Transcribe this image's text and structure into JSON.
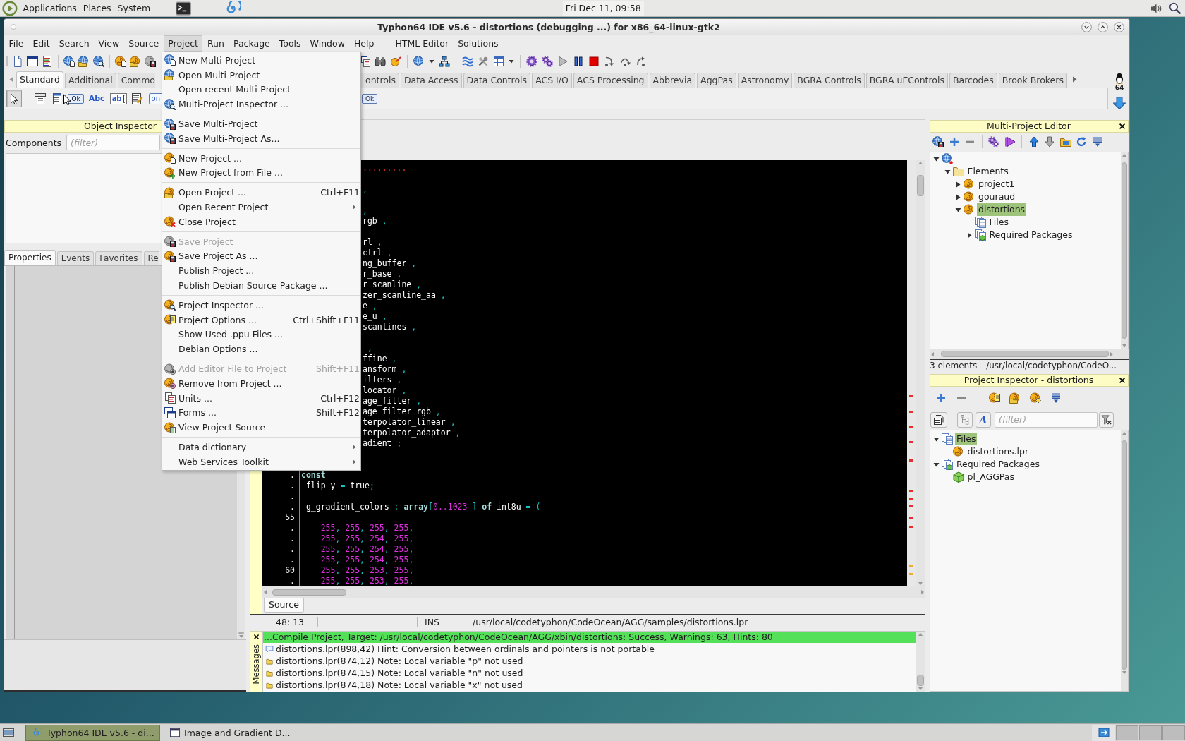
{
  "top_panel": {
    "menus": [
      "Applications",
      "Places",
      "System"
    ],
    "clock": "Fri Dec 11, 09:58"
  },
  "window": {
    "title": "Typhon64 IDE v5.6 - distortions (debugging ...) for x86_64-linux-gtk2"
  },
  "menu_bar": [
    {
      "label": "File",
      "selected": false
    },
    {
      "label": "Edit",
      "selected": false
    },
    {
      "label": "Search",
      "selected": false
    },
    {
      "label": "View",
      "selected": false
    },
    {
      "label": "Source",
      "selected": false
    },
    {
      "label": "Project",
      "selected": true
    },
    {
      "label": "Run",
      "selected": false
    },
    {
      "label": "Package",
      "selected": false
    },
    {
      "label": "Tools",
      "selected": false
    },
    {
      "label": "Window",
      "selected": false
    },
    {
      "label": "Help",
      "selected": false
    },
    {
      "label": "HTML Editor",
      "selected": false
    },
    {
      "label": "Solutions",
      "selected": false
    }
  ],
  "project_menu": {
    "groups": [
      [
        {
          "label": "New Multi-Project",
          "disabled": false,
          "submenu": false
        },
        {
          "label": "Open Multi-Project",
          "disabled": false,
          "submenu": false
        },
        {
          "label": "Open recent Multi-Project",
          "disabled": false,
          "submenu": false
        },
        {
          "label": "Multi-Project Inspector ...",
          "disabled": false,
          "submenu": false
        }
      ],
      [
        {
          "label": "Save Multi-Project",
          "disabled": false,
          "submenu": false
        },
        {
          "label": "Save Multi-Project As...",
          "disabled": false,
          "submenu": false
        }
      ],
      [
        {
          "label": "New Project ...",
          "disabled": false,
          "submenu": false
        },
        {
          "label": "New Project from File ...",
          "disabled": false,
          "submenu": false
        }
      ],
      [
        {
          "label": "Open Project ...",
          "shortcut": "Ctrl+F11",
          "disabled": false,
          "submenu": false
        },
        {
          "label": "Open Recent Project",
          "disabled": false,
          "submenu": true
        },
        {
          "label": "Close Project",
          "disabled": false,
          "submenu": false
        }
      ],
      [
        {
          "label": "Save Project",
          "disabled": true,
          "submenu": false
        },
        {
          "label": "Save Project As ...",
          "disabled": false,
          "submenu": false
        },
        {
          "label": "Publish Project ...",
          "disabled": false,
          "submenu": false
        },
        {
          "label": "Publish Debian Source Package ...",
          "disabled": false,
          "submenu": false
        }
      ],
      [
        {
          "label": "Project Inspector ...",
          "disabled": false,
          "submenu": false
        },
        {
          "label": "Project Options ...",
          "shortcut": "Ctrl+Shift+F11",
          "disabled": false,
          "submenu": false
        },
        {
          "label": "Show Used .ppu Files ...",
          "disabled": false,
          "submenu": false
        },
        {
          "label": "Debian Options ...",
          "disabled": false,
          "submenu": false
        }
      ],
      [
        {
          "label": "Add Editor File to Project",
          "shortcut": "Shift+F11",
          "disabled": true,
          "submenu": false
        },
        {
          "label": "Remove from Project ...",
          "disabled": false,
          "submenu": false
        },
        {
          "label": "Units ...",
          "shortcut": "Ctrl+F12",
          "disabled": false,
          "submenu": false
        },
        {
          "label": "Forms ...",
          "shortcut": "Shift+F12",
          "disabled": false,
          "submenu": false
        },
        {
          "label": "View Project Source",
          "disabled": false,
          "submenu": false
        }
      ],
      [
        {
          "label": "Data dictionary",
          "disabled": false,
          "submenu": true
        },
        {
          "label": "Web Services Toolkit",
          "disabled": false,
          "submenu": true
        }
      ]
    ]
  },
  "component_palette": {
    "tabs": [
      {
        "label": "Standard",
        "selected": true
      },
      {
        "label": "Additional",
        "selected": false
      },
      {
        "label": "Commo",
        "selected": false
      },
      {
        "label": "ontrols",
        "selected": false
      },
      {
        "label": "Data Access",
        "selected": false
      },
      {
        "label": "Data Controls",
        "selected": false
      },
      {
        "label": "ACS I/O",
        "selected": false
      },
      {
        "label": "ACS Processing",
        "selected": false
      },
      {
        "label": "Abbrevia",
        "selected": false
      },
      {
        "label": "AggPas",
        "selected": false
      },
      {
        "label": "Astronomy",
        "selected": false
      },
      {
        "label": "BGRA Controls",
        "selected": false
      },
      {
        "label": "BGRA uEControls",
        "selected": false
      },
      {
        "label": "Barcodes",
        "selected": false
      },
      {
        "label": "Brook Brokers",
        "selected": false
      }
    ],
    "components": [
      {
        "selected": true
      },
      {
        "selected": false
      },
      {
        "selected": false
      },
      {
        "selected": false,
        "text": "Ok"
      },
      {
        "selected": false,
        "text": "Abc"
      },
      {
        "selected": false,
        "text": "ab"
      },
      {
        "selected": false
      },
      {
        "selected": false,
        "text": "on"
      },
      {
        "selected": false,
        "text": "Ok"
      }
    ],
    "platform_badge": "64"
  },
  "object_inspector": {
    "title": "Object Inspector",
    "components_label": "Components",
    "filter_placeholder": "(filter)",
    "tabs": [
      {
        "label": "Properties",
        "selected": true
      },
      {
        "label": "Events",
        "selected": false
      },
      {
        "label": "Favorites",
        "selected": false
      },
      {
        "label": "Re",
        "selected": false
      }
    ]
  },
  "editor": {
    "line_groups_under_menu": [
      [
        {
          "tokens": [
            {
              "kind": "mark",
              "text": "........."
            }
          ]
        }
      ],
      [
        {
          "tokens": [
            {
              "kind": "sym",
              "text": ","
            }
          ]
        }
      ],
      [
        {
          "tokens": [
            {
              "kind": "sym",
              "text": ","
            }
          ]
        },
        {
          "tokens": [
            {
              "kind": "id",
              "text": "rgb"
            },
            {
              "kind": "sym",
              "text": " ,"
            }
          ]
        }
      ],
      [
        {
          "tokens": [
            {
              "kind": "id",
              "text": "rl"
            },
            {
              "kind": "sym",
              "text": " ,"
            }
          ]
        },
        {
          "tokens": [
            {
              "kind": "id",
              "text": "ctrl"
            },
            {
              "kind": "sym",
              "text": " ,"
            }
          ]
        },
        {
          "tokens": [
            {
              "kind": "id",
              "text": "ng_buffer"
            },
            {
              "kind": "sym",
              "text": " ,"
            }
          ]
        },
        {
          "tokens": [
            {
              "kind": "id",
              "text": "r_base"
            },
            {
              "kind": "sym",
              "text": " ,"
            }
          ]
        },
        {
          "tokens": [
            {
              "kind": "id",
              "text": "r_scanline"
            },
            {
              "kind": "sym",
              "text": " ,"
            }
          ]
        },
        {
          "tokens": [
            {
              "kind": "id",
              "text": "zer_scanline_aa"
            },
            {
              "kind": "sym",
              "text": " ,"
            }
          ]
        },
        {
          "tokens": [
            {
              "kind": "id",
              "text": "e"
            },
            {
              "kind": "sym",
              "text": " ,"
            }
          ]
        },
        {
          "tokens": [
            {
              "kind": "id",
              "text": "e_u"
            },
            {
              "kind": "sym",
              "text": " ,"
            }
          ]
        },
        {
          "tokens": [
            {
              "kind": "id",
              "text": "scanlines"
            },
            {
              "kind": "sym",
              "text": " ,"
            }
          ]
        }
      ],
      [
        {
          "tokens": [
            {
              "kind": "sym",
              "text": " ,"
            }
          ]
        },
        {
          "tokens": [
            {
              "kind": "id",
              "text": "ffine"
            },
            {
              "kind": "sym",
              "text": " ,"
            }
          ]
        },
        {
          "tokens": [
            {
              "kind": "id",
              "text": "ansform"
            },
            {
              "kind": "sym",
              "text": " ,"
            }
          ]
        },
        {
          "tokens": [
            {
              "kind": "id",
              "text": "ilters"
            },
            {
              "kind": "sym",
              "text": " ,"
            }
          ]
        },
        {
          "tokens": [
            {
              "kind": "id",
              "text": "locator"
            },
            {
              "kind": "sym",
              "text": " ,"
            }
          ]
        },
        {
          "tokens": [
            {
              "kind": "id",
              "text": "age_filter"
            },
            {
              "kind": "sym",
              "text": " ,"
            }
          ]
        },
        {
          "tokens": [
            {
              "kind": "id",
              "text": "age_filter_rgb"
            },
            {
              "kind": "sym",
              "text": " ,"
            }
          ]
        },
        {
          "tokens": [
            {
              "kind": "id",
              "text": "terpolator_linear"
            },
            {
              "kind": "sym",
              "text": " ,"
            }
          ]
        },
        {
          "tokens": [
            {
              "kind": "id",
              "text": "terpolator_adaptor"
            },
            {
              "kind": "sym",
              "text": " ,"
            }
          ]
        },
        {
          "tokens": [
            {
              "kind": "id",
              "text": "adient"
            },
            {
              "kind": "sym",
              "text": " ;"
            }
          ]
        }
      ]
    ],
    "lines": [
      {
        "gutter": ".",
        "tokens": [
          {
            "kind": "kw",
            "text": "const"
          }
        ]
      },
      {
        "gutter": ".",
        "tokens": [
          {
            "kind": "id",
            "text": " flip_y"
          },
          {
            "kind": "sym",
            "text": " ="
          },
          {
            "kind": "id",
            "text": " true"
          },
          {
            "kind": "sym",
            "text": ";"
          }
        ]
      },
      {
        "gutter": "."
      },
      {
        "gutter": ".",
        "tokens": [
          {
            "kind": "id",
            "text": " g_gradient_colors"
          },
          {
            "kind": "sym",
            "text": " :"
          },
          {
            "kind": "kw",
            "text": " array"
          },
          {
            "kind": "sym",
            "text": "["
          },
          {
            "kind": "num",
            "text": "0..1023"
          },
          {
            "kind": "sym",
            "text": " ]"
          },
          {
            "kind": "kw",
            "text": " of"
          },
          {
            "kind": "id",
            "text": " int8u"
          },
          {
            "kind": "sym",
            "text": " = ("
          }
        ]
      },
      {
        "gutter": "55"
      },
      {
        "gutter": ".",
        "tokens": [
          {
            "kind": "num",
            "text": "    255"
          },
          {
            "kind": "sym",
            "text": ", "
          },
          {
            "kind": "num",
            "text": "255"
          },
          {
            "kind": "sym",
            "text": ", "
          },
          {
            "kind": "num",
            "text": "255"
          },
          {
            "kind": "sym",
            "text": ", "
          },
          {
            "kind": "num",
            "text": "255"
          },
          {
            "kind": "sym",
            "text": ","
          }
        ]
      },
      {
        "gutter": ".",
        "tokens": [
          {
            "kind": "num",
            "text": "    255"
          },
          {
            "kind": "sym",
            "text": ", "
          },
          {
            "kind": "num",
            "text": "255"
          },
          {
            "kind": "sym",
            "text": ", "
          },
          {
            "kind": "num",
            "text": "254"
          },
          {
            "kind": "sym",
            "text": ", "
          },
          {
            "kind": "num",
            "text": "255"
          },
          {
            "kind": "sym",
            "text": ","
          }
        ]
      },
      {
        "gutter": ".",
        "tokens": [
          {
            "kind": "num",
            "text": "    255"
          },
          {
            "kind": "sym",
            "text": ", "
          },
          {
            "kind": "num",
            "text": "255"
          },
          {
            "kind": "sym",
            "text": ", "
          },
          {
            "kind": "num",
            "text": "254"
          },
          {
            "kind": "sym",
            "text": ", "
          },
          {
            "kind": "num",
            "text": "255"
          },
          {
            "kind": "sym",
            "text": ","
          }
        ]
      },
      {
        "gutter": ".",
        "tokens": [
          {
            "kind": "num",
            "text": "    255"
          },
          {
            "kind": "sym",
            "text": ", "
          },
          {
            "kind": "num",
            "text": "255"
          },
          {
            "kind": "sym",
            "text": ", "
          },
          {
            "kind": "num",
            "text": "254"
          },
          {
            "kind": "sym",
            "text": ", "
          },
          {
            "kind": "num",
            "text": "255"
          },
          {
            "kind": "sym",
            "text": ","
          }
        ]
      },
      {
        "gutter": "60",
        "tokens": [
          {
            "kind": "num",
            "text": "    255"
          },
          {
            "kind": "sym",
            "text": ", "
          },
          {
            "kind": "num",
            "text": "255"
          },
          {
            "kind": "sym",
            "text": ", "
          },
          {
            "kind": "num",
            "text": "253"
          },
          {
            "kind": "sym",
            "text": ", "
          },
          {
            "kind": "num",
            "text": "255"
          },
          {
            "kind": "sym",
            "text": ","
          }
        ]
      },
      {
        "gutter": ".",
        "tokens": [
          {
            "kind": "num",
            "text": "    255"
          },
          {
            "kind": "sym",
            "text": ", "
          },
          {
            "kind": "num",
            "text": "255"
          },
          {
            "kind": "sym",
            "text": ", "
          },
          {
            "kind": "num",
            "text": "253"
          },
          {
            "kind": "sym",
            "text": ", "
          },
          {
            "kind": "num",
            "text": "255"
          },
          {
            "kind": "sym",
            "text": ","
          }
        ]
      }
    ],
    "tabs": [
      {
        "label": "Source",
        "selected": true
      }
    ],
    "status": {
      "position": "48: 13",
      "mode": "INS",
      "file": "/usr/local/codetyphon/CodeOcean/AGG/samples/distortions.lpr"
    }
  },
  "messages": {
    "title": "Messages",
    "summary": {
      "succeeded": true,
      "text": "...Compile Project, Target: /usr/local/codetyphon/CodeOcean/AGG/xbin/distortions: Success, Warnings: 63, Hints: 80"
    },
    "items": [
      {
        "kind": "hint",
        "text": "distortions.lpr(898,42) Hint: Conversion between ordinals and pointers is not portable"
      },
      {
        "kind": "note",
        "text": "distortions.lpr(874,12) Note: Local variable \"p\" not used"
      },
      {
        "kind": "note",
        "text": "distortions.lpr(874,15) Note: Local variable \"n\" not used"
      },
      {
        "kind": "note",
        "text": "distortions.lpr(874,18) Note: Local variable \"x\" not used"
      }
    ]
  },
  "multi_project_editor": {
    "title": "Multi-Project Editor",
    "tree": [
      {
        "kind": "root",
        "expanded": true,
        "selected": false,
        "children": [
          {
            "kind": "folder",
            "label": "Elements",
            "expanded": true,
            "selected": false,
            "children": [
              {
                "kind": "project",
                "label": "project1",
                "expanded": false,
                "selected": false
              },
              {
                "kind": "project",
                "label": "gouraud",
                "expanded": false,
                "selected": false
              },
              {
                "kind": "project",
                "label": "distortions",
                "expanded": true,
                "selected": true,
                "children": [
                  {
                    "kind": "files",
                    "label": "Files",
                    "selected": false
                  },
                  {
                    "kind": "packages",
                    "label": "Required Packages",
                    "expanded": false,
                    "selected": false
                  }
                ]
              }
            ]
          }
        ]
      }
    ],
    "status": {
      "count": "3 elements",
      "path": "/usr/local/codetyphon/CodeO..."
    }
  },
  "project_inspector": {
    "title": "Project Inspector - distortions",
    "text_button": "A",
    "filter_placeholder": "(filter)",
    "tree": [
      {
        "kind": "files",
        "label": "Files",
        "expanded": true,
        "selected": true,
        "children": [
          {
            "kind": "project",
            "label": "distortions.lpr",
            "selected": false
          }
        ]
      },
      {
        "kind": "packages",
        "label": "Required Packages",
        "expanded": true,
        "selected": false,
        "children": [
          {
            "kind": "package",
            "label": "pl_AGGPas",
            "selected": false
          }
        ]
      }
    ]
  },
  "taskbar": {
    "tasks": [
      {
        "label": "Typhon64 IDE v5.6 - di...",
        "selected": true
      },
      {
        "label": "Image and Gradient D...",
        "selected": false
      }
    ]
  }
}
